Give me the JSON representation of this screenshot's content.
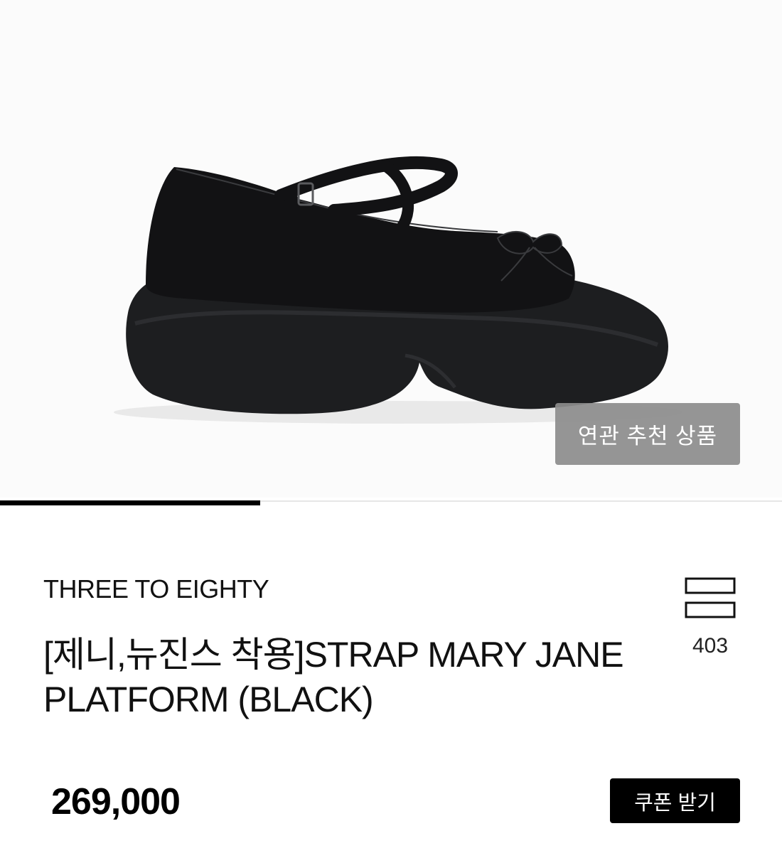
{
  "product": {
    "image_alt_icon": "mary-jane-platform-shoe",
    "related_button": "연관 추천 상품",
    "image_progress": 0.333,
    "brand": "THREE TO EIGHTY",
    "title": "[제니,뉴진스 착용]STRAP MARY JANE PLATFORM (BLACK)",
    "like_icon": "stack-icon",
    "like_count": "403",
    "price": "269,000",
    "coupon_button": "쿠폰 받기"
  },
  "colors": {
    "accent": "#000000",
    "overlay_button": "#8c8c8c",
    "text": "#111111"
  }
}
